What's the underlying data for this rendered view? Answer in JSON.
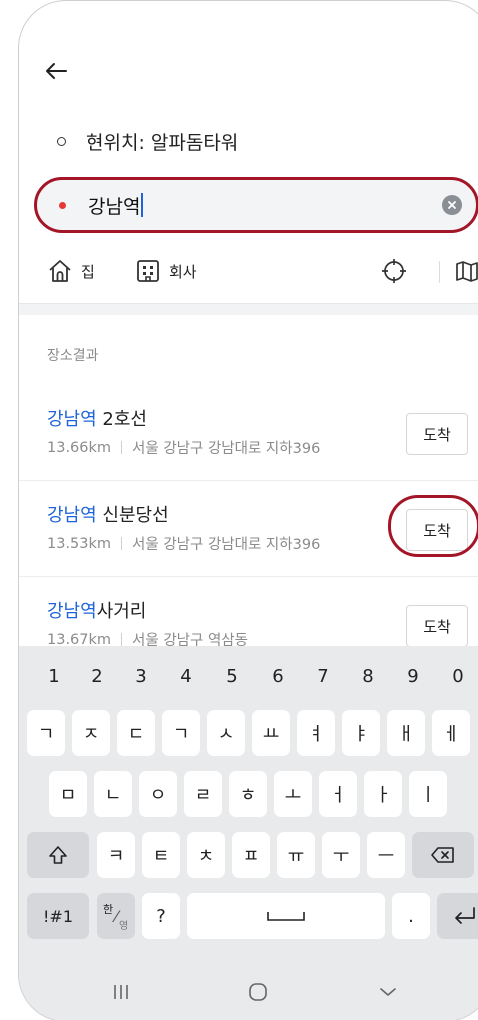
{
  "origin": {
    "label": "현위치: 알파돔타워"
  },
  "search": {
    "value": "강남역"
  },
  "shortcuts": {
    "home": "집",
    "office": "회사"
  },
  "section_label": "장소결과",
  "results": [
    {
      "highlight": "강남역",
      "rest": " 2호선",
      "distance": "13.66km",
      "address": "서울 강남구 강남대로 지하396",
      "action": "도착"
    },
    {
      "highlight": "강남역",
      "rest": " 신분당선",
      "distance": "13.53km",
      "address": "서울 강남구 강남대로 지하396",
      "action": "도착"
    },
    {
      "highlight": "강남역",
      "rest": "사거리",
      "distance": "13.67km",
      "address": "서울 강남구 역삼동",
      "action": "도착"
    }
  ],
  "keyboard": {
    "numbers": [
      "1",
      "2",
      "3",
      "4",
      "5",
      "6",
      "7",
      "8",
      "9",
      "0"
    ],
    "row1": [
      "ㄱ",
      "ㅈ",
      "ㄷ",
      "ㄱ",
      "ㅅ",
      "ㅛ",
      "ㅕ",
      "ㅑ",
      "ㅐ",
      "ㅔ"
    ],
    "row2": [
      "ㅁ",
      "ㄴ",
      "ㅇ",
      "ㄹ",
      "ㅎ",
      "ㅗ",
      "ㅓ",
      "ㅏ",
      "ㅣ"
    ],
    "row3": [
      "ㅋ",
      "ㅌ",
      "ㅊ",
      "ㅍ",
      "ㅠ",
      "ㅜ",
      "ㅡ"
    ],
    "symbols": "!#1",
    "lang_top": "한",
    "lang_bottom": "영",
    "question": "?",
    "period": "."
  },
  "colors": {
    "highlight": "#1e64d8",
    "annotation": "#a31627",
    "keyboard_bg": "#e9eaec"
  }
}
